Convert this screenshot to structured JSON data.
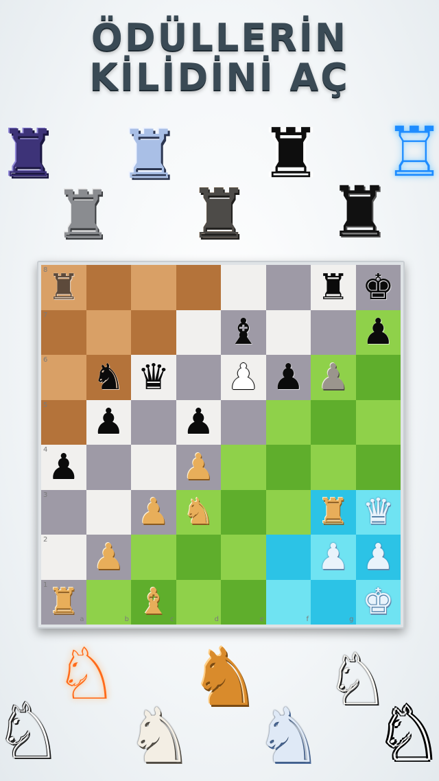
{
  "headline": {
    "line1": "ÖDÜLLERİN",
    "line2": "KİLİDİNİ AÇ"
  },
  "decor_rooks": [
    {
      "name": "rook-purple-icon",
      "glyph": "♜"
    },
    {
      "name": "rook-silver-icon",
      "glyph": "♜"
    },
    {
      "name": "rook-blue-icon",
      "glyph": "♜"
    },
    {
      "name": "rook-castle-icon",
      "glyph": "♜"
    },
    {
      "name": "rook-pixel-icon",
      "glyph": "♜"
    },
    {
      "name": "rook-black-icon",
      "glyph": "♜"
    },
    {
      "name": "rook-neon-icon",
      "glyph": "♖"
    }
  ],
  "board": {
    "files": [
      "a",
      "b",
      "c",
      "d",
      "e",
      "f",
      "g",
      "h"
    ],
    "ranks": [
      "8",
      "7",
      "6",
      "5",
      "4",
      "3",
      "2",
      "1"
    ],
    "rank_labels": [
      "8",
      "7",
      "6",
      "5",
      "4",
      "3",
      "2",
      "1"
    ],
    "file_labels": [
      "a",
      "b",
      "c",
      "d",
      "e",
      "f",
      "g"
    ],
    "pieces": [
      {
        "sq": "a8",
        "glyph": "♜",
        "style": "bp-rook-brown",
        "name": "black-rook-icon"
      },
      {
        "sq": "g8",
        "glyph": "♜",
        "style": "",
        "name": "black-rook-icon"
      },
      {
        "sq": "h8",
        "glyph": "♚",
        "style": "",
        "name": "black-king-icon"
      },
      {
        "sq": "e7",
        "glyph": "♝",
        "style": "",
        "name": "black-bishop-icon"
      },
      {
        "sq": "h7",
        "glyph": "♟",
        "style": "",
        "name": "black-pawn-icon"
      },
      {
        "sq": "b6",
        "glyph": "♞",
        "style": "",
        "name": "black-knight-icon"
      },
      {
        "sq": "c6",
        "glyph": "♛",
        "style": "",
        "name": "black-queen-icon"
      },
      {
        "sq": "e6",
        "glyph": "♟",
        "style": "bp-white",
        "name": "white-pawn-icon"
      },
      {
        "sq": "f6",
        "glyph": "♟",
        "style": "",
        "name": "black-pawn-icon"
      },
      {
        "sq": "g6",
        "glyph": "♟",
        "style": "bp-stone",
        "name": "stone-pawn-icon"
      },
      {
        "sq": "b5",
        "glyph": "♟",
        "style": "",
        "name": "black-pawn-icon"
      },
      {
        "sq": "d5",
        "glyph": "♟",
        "style": "",
        "name": "black-pawn-icon"
      },
      {
        "sq": "a4",
        "glyph": "♟",
        "style": "",
        "name": "black-pawn-icon"
      },
      {
        "sq": "d4",
        "glyph": "♟",
        "style": "bp-gold",
        "name": "gold-pawn-icon"
      },
      {
        "sq": "c3",
        "glyph": "♟",
        "style": "bp-gold",
        "name": "gold-pawn-icon"
      },
      {
        "sq": "d3",
        "glyph": "♞",
        "style": "bp-gold",
        "name": "gold-knight-icon"
      },
      {
        "sq": "g3",
        "glyph": "♜",
        "style": "bp-gold",
        "name": "gold-rook-icon"
      },
      {
        "sq": "h3",
        "glyph": "♛",
        "style": "bp-ice",
        "name": "ice-queen-icon"
      },
      {
        "sq": "b2",
        "glyph": "♟",
        "style": "bp-gold",
        "name": "gold-pawn-icon"
      },
      {
        "sq": "g2",
        "glyph": "♟",
        "style": "bp-ice",
        "name": "ice-pawn-icon"
      },
      {
        "sq": "h2",
        "glyph": "♟",
        "style": "bp-ice",
        "name": "ice-pawn-icon"
      },
      {
        "sq": "a1",
        "glyph": "♜",
        "style": "bp-gold",
        "name": "gold-rook-icon"
      },
      {
        "sq": "c1",
        "glyph": "♝",
        "style": "bp-gold",
        "name": "gold-bishop-icon"
      },
      {
        "sq": "h1",
        "glyph": "♚",
        "style": "bp-ice",
        "name": "ice-king-icon"
      }
    ],
    "themes": {
      "wood_light": "#d9a066",
      "wood_dark": "#b4733a",
      "marble_light": "#f1f0ee",
      "marble_dark": "#9e9aa6",
      "grass_light": "#8fd14a",
      "grass_dark": "#5fae2c",
      "ice_light": "#6fe3f2",
      "ice_dark": "#2cc3e6"
    }
  },
  "decor_knights": [
    {
      "name": "knight-neon-icon",
      "glyph": "♘"
    },
    {
      "name": "knight-white-icon",
      "glyph": "♘"
    },
    {
      "name": "knight-ivory-icon",
      "glyph": "♞"
    },
    {
      "name": "knight-gold-icon",
      "glyph": "♞"
    },
    {
      "name": "knight-blue-icon",
      "glyph": "♞"
    },
    {
      "name": "knight-white-2-icon",
      "glyph": "♘"
    },
    {
      "name": "knight-pixel-icon",
      "glyph": "♘"
    }
  ]
}
